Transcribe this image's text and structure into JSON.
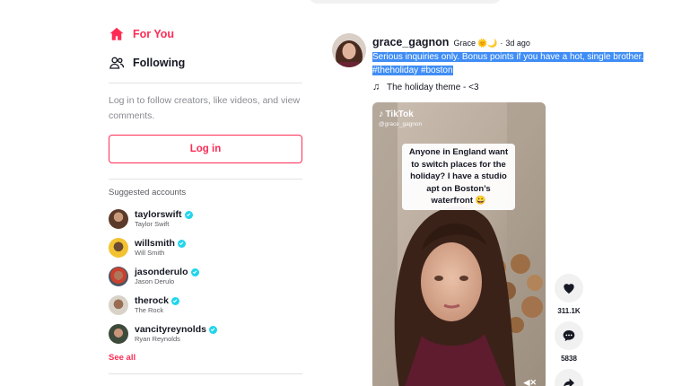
{
  "sidebar": {
    "nav": [
      {
        "label": "For You",
        "icon": "home-icon",
        "active": true,
        "color": "#fe2c55"
      },
      {
        "label": "Following",
        "icon": "people-icon",
        "active": false
      }
    ],
    "login_hint": "Log in to follow creators, like videos, and view comments.",
    "login_button": "Log in",
    "suggested_title": "Suggested accounts",
    "accounts": [
      {
        "handle": "taylorswift",
        "name": "Taylor Swift",
        "verified": true
      },
      {
        "handle": "willsmith",
        "name": "Will Smith",
        "verified": true
      },
      {
        "handle": "jasonderulo",
        "name": "Jason Derulo",
        "verified": true
      },
      {
        "handle": "therock",
        "name": "The Rock",
        "verified": true
      },
      {
        "handle": "vancityreynolds",
        "name": "Ryan Reynolds",
        "verified": true
      }
    ],
    "see_all": "See all"
  },
  "post": {
    "username": "grace_gagnon",
    "nickname": "Grace",
    "nickname_emoji": "🌞🌙",
    "separator": "·",
    "age": "3d ago",
    "caption_text": "Serious inquiries only. Bonus points if you have a hot, single brother.",
    "hashtags": [
      "#theholiday",
      "#boston"
    ],
    "music": "The holiday theme - <3",
    "video": {
      "watermark": "TikTok",
      "watermark_user": "@grace_gagnon",
      "overlay_text": "Anyone in England want to switch places for the holiday? I have a studio apt on Boston’s waterfront 😀"
    },
    "actions": [
      {
        "icon": "heart-icon",
        "count": "311.1K"
      },
      {
        "icon": "comment-icon",
        "count": "5838"
      },
      {
        "icon": "share-icon",
        "count": ""
      }
    ]
  },
  "colors": {
    "accent": "#fe2c55",
    "verified": "#20d5ec",
    "selection": "#3f8df5"
  }
}
